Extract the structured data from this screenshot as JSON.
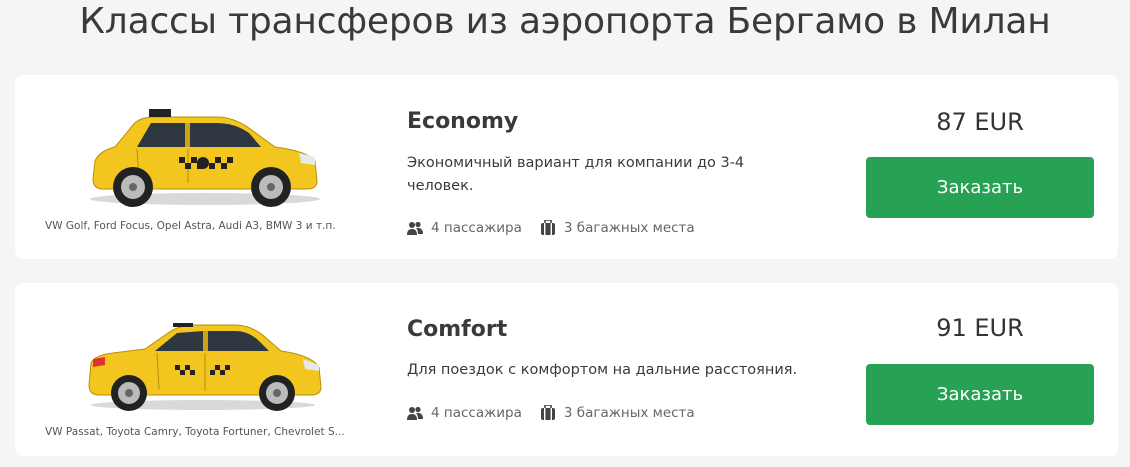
{
  "page": {
    "title": "Классы трансферов из аэропорта Бергамо в Милан"
  },
  "cards": [
    {
      "car_models": "VW Golf, Ford Focus, Opel Astra, Audi A3, BMW 3 и т.п.",
      "class_name": "Economy",
      "description": "Экономичный вариант для компании до 3-4 человек.",
      "passengers": "4 пассажира",
      "luggage": "3 багажных места",
      "price": "87 EUR",
      "order_label": "Заказать",
      "car_icon": "hatchback-taxi-image"
    },
    {
      "car_models": "VW Passat, Toyota Camry, Toyota Fortuner, Chevrolet S...",
      "class_name": "Comfort",
      "description": "Для поездок с комфортом на дальние расстояния.",
      "passengers": "4 пассажира",
      "luggage": "3 багажных места",
      "price": "91 EUR",
      "order_label": "Заказать",
      "car_icon": "sedan-taxi-image"
    }
  ],
  "colors": {
    "accent_button": "#27a153",
    "taxi_yellow": "#f2c61f",
    "background": "#f4f5f7"
  }
}
